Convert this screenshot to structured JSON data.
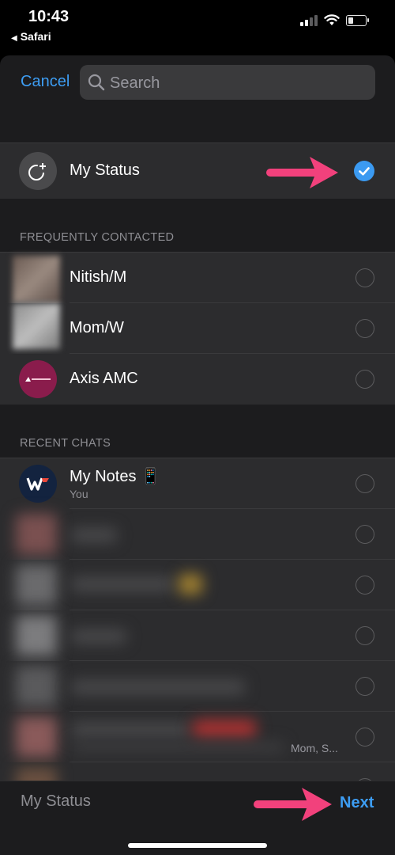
{
  "status_bar": {
    "time": "10:43",
    "back_app": "Safari"
  },
  "header": {
    "cancel_label": "Cancel",
    "search_placeholder": "Search"
  },
  "my_status_row": {
    "label": "My Status",
    "selected": true
  },
  "frequently_contacted": {
    "header": "FREQUENTLY CONTACTED",
    "contacts": [
      {
        "name": "Nitish/M"
      },
      {
        "name": "Mom/W"
      },
      {
        "name": "Axis AMC"
      }
    ]
  },
  "recent_chats": {
    "header": "RECENT CHATS",
    "first": {
      "name": "My Notes 📱",
      "subtitle": "You"
    },
    "group_members_snippet": "Mom, S..."
  },
  "bottom_bar": {
    "selected_label": "My Status",
    "next_label": "Next"
  },
  "colors": {
    "accent": "#3d9df3",
    "annotation_arrow": "#f2417c",
    "row_bg": "#2c2c2e",
    "sheet_bg": "#1c1c1e"
  }
}
